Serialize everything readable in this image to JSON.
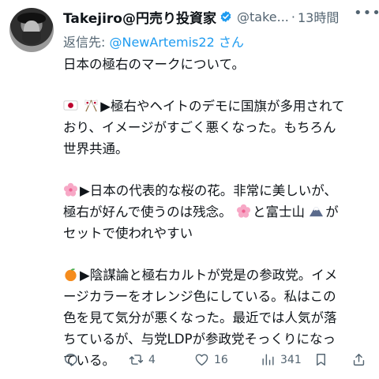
{
  "author": {
    "display_name": "Takejiro@円売り投資家",
    "handle": "@take...",
    "separator": "·",
    "time": "13時間"
  },
  "reply": {
    "prefix": "返信先: ",
    "to": "@NewArtemis22 さん"
  },
  "body": {
    "l1": "日本の極右のマークについて。",
    "l2": "▶極右やヘイトのデモに国旗が多用されて",
    "l3": "おり、イメージがすごく悪くなった。もちろん",
    "l4": "世界共通。",
    "l5": "▶日本の代表的な桜の花。非常に美しいが、",
    "l6a": "極右が好んで使うのは残念。",
    "l6b": "と富士山",
    "l6c": "が",
    "l7": "セットで使われやすい",
    "l8": "▶陰謀論と極右カルトが党是の参政党。イメ",
    "l9": "ージカラーをオレンジ色にしている。私はこの",
    "l10": "色を見て気分が悪くなった。最近では人気が落",
    "l11": "ちているが、与党LDPが参政党そっくりになっ",
    "l12": "ている。"
  },
  "emoji": {
    "jp_flag": "flag-japan-icon",
    "crossed_flags": "crossed-flags-icon",
    "sakura": "cherry-blossom-icon",
    "fuji": "mount-fuji-icon",
    "orange": "tangerine-icon"
  },
  "actions": {
    "replies": "",
    "retweets": "4",
    "likes": "16",
    "views": "341"
  },
  "colors": {
    "accent": "#1d9bf0",
    "muted": "#536471",
    "text": "#0f1419"
  }
}
